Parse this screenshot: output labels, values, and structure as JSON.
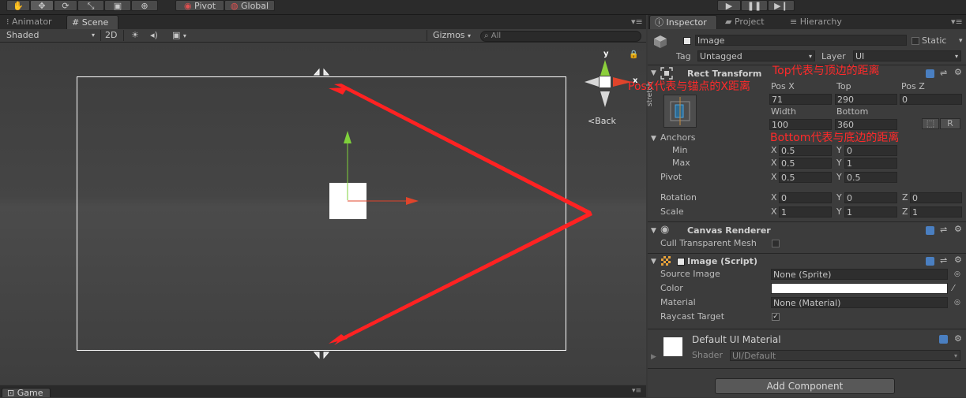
{
  "toolbar": {
    "pivot": "Pivot",
    "global": "Global"
  },
  "left_tabs": {
    "animator": "Animator",
    "scene": "Scene"
  },
  "scene_bar": {
    "shading": "Shaded",
    "mode_2d": "2D",
    "gizmos": "Gizmos",
    "search_placeholder": "All"
  },
  "gizmo": {
    "x_label": "x",
    "y_label": "y",
    "back": "Back"
  },
  "bottom_tabs": {
    "game": "Game"
  },
  "inspector_tabs": {
    "inspector": "Inspector",
    "project": "Project",
    "hierarchy": "Hierarchy"
  },
  "object": {
    "name": "Image",
    "static": "Static",
    "tag_label": "Tag",
    "tag": "Untagged",
    "layer_label": "Layer",
    "layer": "UI"
  },
  "rect_transform": {
    "title": "Rect Transform",
    "stretch": "stretch",
    "labels": {
      "pos_x": "Pos X",
      "top": "Top",
      "pos_z": "Pos Z",
      "width": "Width",
      "bottom": "Bottom"
    },
    "values": {
      "pos_x": "71",
      "top": "290",
      "pos_z": "0",
      "width": "100",
      "bottom": "360"
    },
    "r_button": "R",
    "anchors_label": "Anchors",
    "min_label": "Min",
    "max_label": "Max",
    "anchor_min": {
      "x": "0.5",
      "y": "0"
    },
    "anchor_max": {
      "x": "0.5",
      "y": "1"
    },
    "pivot_label": "Pivot",
    "pivot": {
      "x": "0.5",
      "y": "0.5"
    },
    "rotation_label": "Rotation",
    "rotation": {
      "x": "0",
      "y": "0",
      "z": "0"
    },
    "scale_label": "Scale",
    "scale": {
      "x": "1",
      "y": "1",
      "z": "1"
    },
    "axis": {
      "x": "X",
      "y": "Y",
      "z": "Z"
    }
  },
  "canvas_renderer": {
    "title": "Canvas Renderer",
    "cull_label": "Cull Transparent Mesh"
  },
  "image_script": {
    "title": "Image (Script)",
    "source_label": "Source Image",
    "source_value": "None (Sprite)",
    "color_label": "Color",
    "material_label": "Material",
    "material_value": "None (Material)",
    "raycast_label": "Raycast Target"
  },
  "material": {
    "name": "Default UI Material",
    "shader_label": "Shader",
    "shader_value": "UI/Default"
  },
  "add_component": "Add Component",
  "annotations": {
    "top": "Top代表与顶边的距离",
    "posx": "PosX代表与锚点的X距离",
    "bottom": "Bottom代表与底边的距离"
  },
  "colors": {
    "annotation": "#ff2a2a",
    "selected_rect": "#ffffff",
    "y_axis": "#7fd13b",
    "x_axis": "#e0442b"
  }
}
